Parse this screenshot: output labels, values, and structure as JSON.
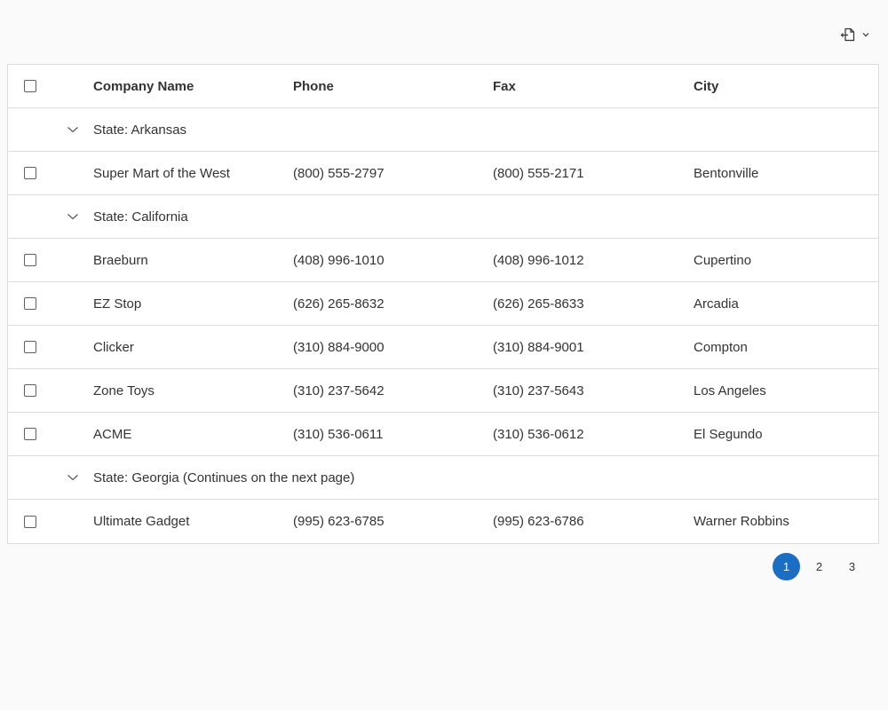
{
  "toolbar": {
    "export_icon": "export-icon",
    "dropdown_icon": "chevron-down-icon"
  },
  "grid": {
    "columns": {
      "company": "Company Name",
      "phone": "Phone",
      "fax": "Fax",
      "city": "City"
    },
    "groups": [
      {
        "label": "State: Arkansas",
        "rows": [
          {
            "company": "Super Mart of the West",
            "phone": "(800) 555-2797",
            "fax": "(800) 555-2171",
            "city": "Bentonville"
          }
        ]
      },
      {
        "label": "State: California",
        "rows": [
          {
            "company": "Braeburn",
            "phone": "(408) 996-1010",
            "fax": "(408) 996-1012",
            "city": "Cupertino"
          },
          {
            "company": "EZ Stop",
            "phone": "(626) 265-8632",
            "fax": "(626) 265-8633",
            "city": "Arcadia"
          },
          {
            "company": "Clicker",
            "phone": "(310) 884-9000",
            "fax": "(310) 884-9001",
            "city": "Compton"
          },
          {
            "company": "Zone Toys",
            "phone": "(310) 237-5642",
            "fax": "(310) 237-5643",
            "city": "Los Angeles"
          },
          {
            "company": "ACME",
            "phone": "(310) 536-0611",
            "fax": "(310) 536-0612",
            "city": "El Segundo"
          }
        ]
      },
      {
        "label": "State: Georgia (Continues on the next page)",
        "rows": [
          {
            "company": "Ultimate Gadget",
            "phone": "(995) 623-6785",
            "fax": "(995) 623-6786",
            "city": "Warner Robbins"
          }
        ]
      }
    ]
  },
  "pager": {
    "pages": [
      "1",
      "2",
      "3"
    ],
    "active": "1"
  },
  "colors": {
    "accent": "#1a6fc4",
    "border": "#dddddd",
    "background": "#fafafa"
  }
}
